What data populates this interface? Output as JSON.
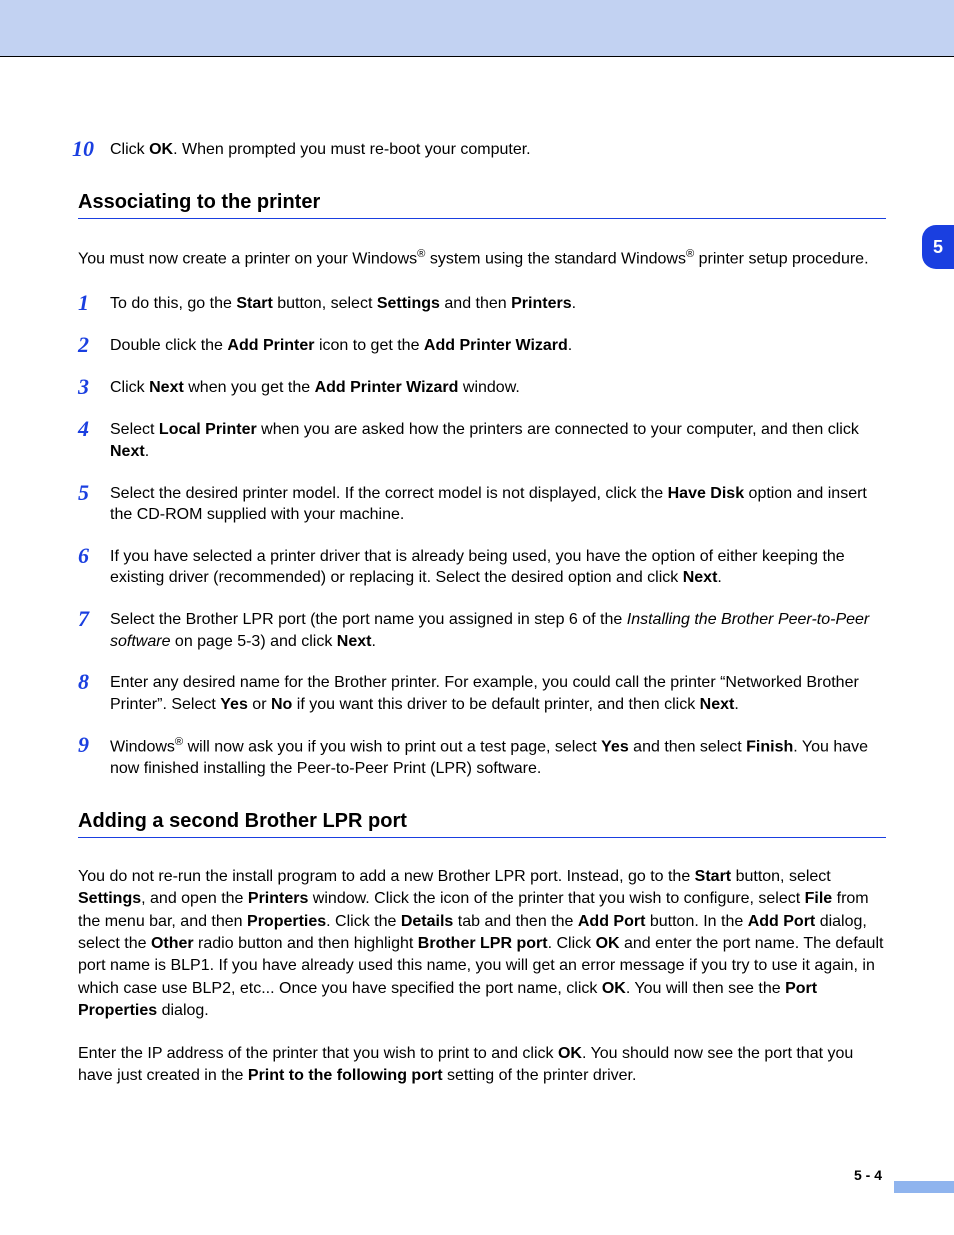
{
  "sideTab": "5",
  "pageNumber": "5 - 4",
  "step10": {
    "num": "10",
    "pre": "Click ",
    "b1": "OK",
    "post": ". When prompted you must re-boot your computer."
  },
  "section1": {
    "heading": "Associating to the printer",
    "intro": {
      "t1": "You must now create a printer on your Windows",
      "sup1": "®",
      "t2": " system using the standard Windows",
      "sup2": "®",
      "t3": " printer setup procedure."
    },
    "steps": [
      {
        "num": "1",
        "parts": [
          {
            "t": "To do this, go the "
          },
          {
            "b": "Start"
          },
          {
            "t": " button, select "
          },
          {
            "b": "Settings"
          },
          {
            "t": " and then "
          },
          {
            "b": "Printers"
          },
          {
            "t": "."
          }
        ]
      },
      {
        "num": "2",
        "parts": [
          {
            "t": "Double click the "
          },
          {
            "b": "Add Printer"
          },
          {
            "t": " icon to get the "
          },
          {
            "b": "Add Printer Wizard"
          },
          {
            "t": "."
          }
        ]
      },
      {
        "num": "3",
        "parts": [
          {
            "t": "Click "
          },
          {
            "b": "Next"
          },
          {
            "t": " when you get the "
          },
          {
            "b": "Add Printer Wizard"
          },
          {
            "t": " window."
          }
        ]
      },
      {
        "num": "4",
        "parts": [
          {
            "t": "Select "
          },
          {
            "b": "Local Printer"
          },
          {
            "t": " when you are asked how the printers are connected to your computer, and then click "
          },
          {
            "b": "Next"
          },
          {
            "t": "."
          }
        ]
      },
      {
        "num": "5",
        "parts": [
          {
            "t": "Select the desired printer model. If the correct model is not displayed, click the "
          },
          {
            "b": "Have Disk"
          },
          {
            "t": " option and insert the CD-ROM supplied with your machine."
          }
        ]
      },
      {
        "num": "6",
        "parts": [
          {
            "t": "If you have selected a printer driver that is already being used, you have the option of either keeping the existing driver (recommended) or replacing it. Select the desired option and click "
          },
          {
            "b": "Next"
          },
          {
            "t": "."
          }
        ]
      },
      {
        "num": "7",
        "parts": [
          {
            "t": "Select the Brother LPR port (the port name you assigned in step 6 of the "
          },
          {
            "i": "Installing the Brother Peer-to-Peer software"
          },
          {
            "t": " on page 5-3) and click "
          },
          {
            "b": "Next"
          },
          {
            "t": "."
          }
        ]
      },
      {
        "num": "8",
        "parts": [
          {
            "t": "Enter any desired name for the Brother printer. For example, you could call the printer “Networked Brother Printer”. Select "
          },
          {
            "b": "Yes"
          },
          {
            "t": " or "
          },
          {
            "b": "No"
          },
          {
            "t": " if you want this driver to be default printer, and then click "
          },
          {
            "b": "Next"
          },
          {
            "t": "."
          }
        ]
      },
      {
        "num": "9",
        "parts": [
          {
            "t": "Windows"
          },
          {
            "sup": "®"
          },
          {
            "t": " will now ask you if you wish to print out a test page, select "
          },
          {
            "b": "Yes"
          },
          {
            "t": " and then select "
          },
          {
            "b": "Finish"
          },
          {
            "t": ". You have now finished installing the Peer-to-Peer Print (LPR) software."
          }
        ]
      }
    ]
  },
  "section2": {
    "heading": "Adding a second Brother LPR port",
    "para1_parts": [
      {
        "t": "You do not re-run the install program to add a new Brother LPR port. Instead, go to the "
      },
      {
        "b": "Start"
      },
      {
        "t": " button, select "
      },
      {
        "b": "Settings"
      },
      {
        "t": ", and open the "
      },
      {
        "b": "Printers"
      },
      {
        "t": " window. Click the icon of the printer that you wish to configure, select "
      },
      {
        "b": "File"
      },
      {
        "t": " from the menu bar, and then "
      },
      {
        "b": "Properties"
      },
      {
        "t": ". Click the "
      },
      {
        "b": "Details"
      },
      {
        "t": " tab and then the "
      },
      {
        "b": "Add Port"
      },
      {
        "t": " button. In the "
      },
      {
        "b": "Add Port"
      },
      {
        "t": " dialog, select the "
      },
      {
        "b": "Other"
      },
      {
        "t": " radio button and then highlight "
      },
      {
        "b": "Brother LPR port"
      },
      {
        "t": ". Click "
      },
      {
        "b": "OK"
      },
      {
        "t": " and enter the port name. The default port name is BLP1. If you have already used this name, you will get an error message if you try to use it again, in which case use BLP2, etc... Once you have specified the port name, click "
      },
      {
        "b": "OK"
      },
      {
        "t": ". You will then see the "
      },
      {
        "b": "Port Properties"
      },
      {
        "t": " dialog."
      }
    ],
    "para2_parts": [
      {
        "t": "Enter the IP address of the printer that you wish to print to and click "
      },
      {
        "b": "OK"
      },
      {
        "t": ". You should now see the port that you have just created in the "
      },
      {
        "b": "Print to the following port"
      },
      {
        "t": " setting of the printer driver."
      }
    ]
  }
}
